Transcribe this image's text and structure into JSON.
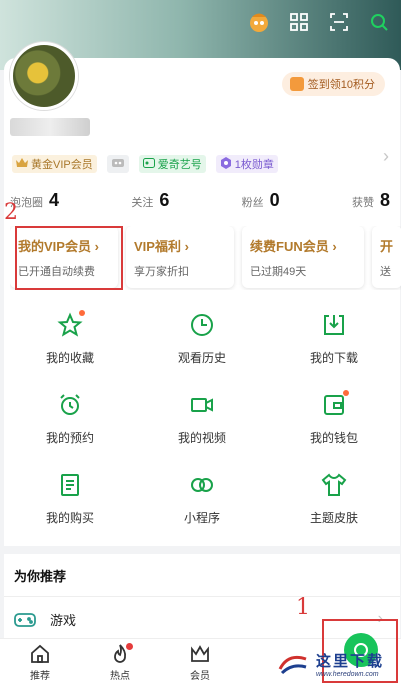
{
  "header": {
    "icons": [
      "mascot-icon",
      "grid-icon",
      "scan-icon",
      "search-icon"
    ]
  },
  "profile": {
    "signin_label": "签到领10积分"
  },
  "badges": [
    {
      "label": "黄金VIP会员",
      "icon": "crown-icon"
    },
    {
      "label": "",
      "icon": "robot-icon"
    },
    {
      "label": "爱奇艺号",
      "icon": "id-card-icon"
    },
    {
      "label": "1枚勋章",
      "icon": "medal-icon"
    }
  ],
  "stats": [
    {
      "label": "泡泡圈",
      "value": "4"
    },
    {
      "label": "关注",
      "value": "6"
    },
    {
      "label": "粉丝",
      "value": "0"
    },
    {
      "label": "获赞",
      "value": "8"
    }
  ],
  "vip_cards": [
    {
      "title": "我的VIP会员 ›",
      "sub": "已开通自动续费"
    },
    {
      "title": "VIP福利 ›",
      "sub": "享万家折扣"
    },
    {
      "title": "续费FUN会员 ›",
      "sub": "已过期49天"
    },
    {
      "title": "开",
      "sub": "送"
    }
  ],
  "grid_items": [
    {
      "label": "我的收藏",
      "icon": "star-icon",
      "dot": true
    },
    {
      "label": "观看历史",
      "icon": "clock-icon",
      "dot": false
    },
    {
      "label": "我的下载",
      "icon": "download-icon",
      "dot": false
    },
    {
      "label": "我的预约",
      "icon": "alarm-icon",
      "dot": false
    },
    {
      "label": "我的视频",
      "icon": "video-camera-icon",
      "dot": false
    },
    {
      "label": "我的钱包",
      "icon": "wallet-icon",
      "dot": true
    },
    {
      "label": "我的购买",
      "icon": "receipt-icon",
      "dot": false
    },
    {
      "label": "小程序",
      "icon": "mini-program-icon",
      "dot": false
    },
    {
      "label": "主题皮肤",
      "icon": "shirt-icon",
      "dot": false
    }
  ],
  "recommend": {
    "title": "为你推荐",
    "items": [
      {
        "label": "游戏",
        "icon": "gamepad-icon"
      }
    ]
  },
  "tabs": [
    {
      "label": "推荐",
      "icon": "home-icon",
      "dot": false
    },
    {
      "label": "热点",
      "icon": "flame-icon",
      "dot": true
    },
    {
      "label": "会员",
      "icon": "crown-outline-icon",
      "dot": false
    }
  ],
  "annotations": {
    "one": "1",
    "two": "2"
  },
  "watermark": {
    "title": "这里下载",
    "url": "www.heredown.com"
  },
  "colors": {
    "accent": "#19a24a",
    "gold": "#b27a2c",
    "annotation": "#d93a3a"
  }
}
